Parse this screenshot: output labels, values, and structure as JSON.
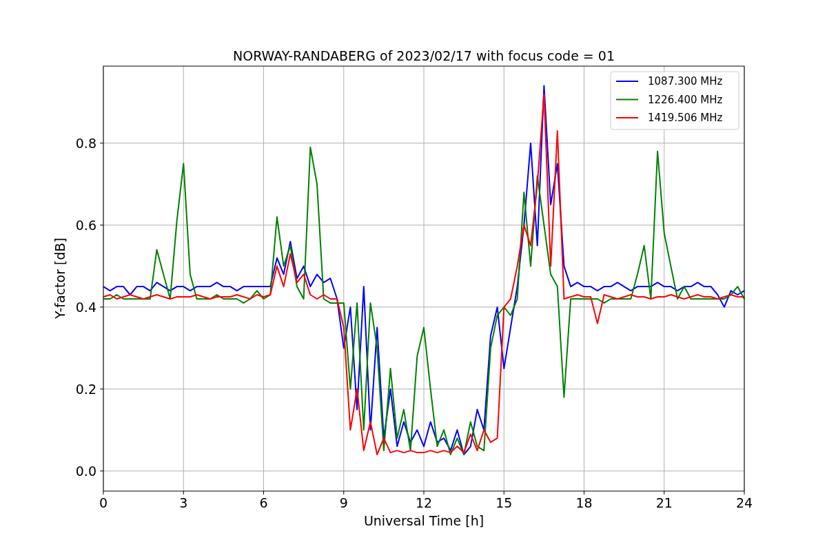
{
  "chart_data": {
    "type": "line",
    "grid": true,
    "legend": true,
    "title": "NORWAY-RANDABERG of 2023/02/17 with focus code = 01",
    "xlabel": "Universal Time [h]",
    "ylabel": "Y-factor [dB]",
    "xlim": [
      0,
      24
    ],
    "ylim": [
      -0.049,
      0.988
    ],
    "xticks": [
      0,
      3,
      6,
      9,
      12,
      15,
      18,
      21,
      24
    ],
    "yticks": [
      {
        "value": 0,
        "label": "0.0"
      },
      {
        "value": 0.2,
        "label": "0.2"
      },
      {
        "value": 0.4,
        "label": "0.4"
      },
      {
        "value": 0.6,
        "label": "0.6"
      },
      {
        "value": 0.8,
        "label": "0.8"
      }
    ],
    "x": [
      0,
      0.25,
      0.5,
      0.75,
      1,
      1.25,
      1.5,
      1.75,
      2,
      2.25,
      2.5,
      2.75,
      3,
      3.25,
      3.5,
      3.75,
      4,
      4.25,
      4.5,
      4.75,
      5,
      5.25,
      5.5,
      5.75,
      6,
      6.25,
      6.5,
      6.75,
      7,
      7.25,
      7.5,
      7.75,
      8,
      8.25,
      8.5,
      8.75,
      9,
      9.25,
      9.5,
      9.75,
      10,
      10.25,
      10.5,
      10.75,
      11,
      11.25,
      11.5,
      11.75,
      12,
      12.25,
      12.5,
      12.75,
      13,
      13.25,
      13.5,
      13.75,
      14,
      14.25,
      14.5,
      14.75,
      15,
      15.25,
      15.5,
      15.75,
      16,
      16.25,
      16.5,
      16.75,
      17,
      17.25,
      17.5,
      17.75,
      18,
      18.25,
      18.5,
      18.75,
      19,
      19.25,
      19.5,
      19.75,
      20,
      20.25,
      20.5,
      20.75,
      21,
      21.25,
      21.5,
      21.75,
      22,
      22.25,
      22.5,
      22.75,
      23,
      23.25,
      23.5,
      23.75,
      24
    ],
    "series": [
      {
        "name": "1087.300 MHz",
        "color": "#0000ff",
        "values": [
          0.45,
          0.44,
          0.45,
          0.45,
          0.43,
          0.45,
          0.45,
          0.44,
          0.46,
          0.45,
          0.44,
          0.45,
          0.45,
          0.44,
          0.45,
          0.45,
          0.45,
          0.46,
          0.45,
          0.45,
          0.44,
          0.45,
          0.45,
          0.45,
          0.45,
          0.45,
          0.52,
          0.48,
          0.56,
          0.47,
          0.5,
          0.45,
          0.48,
          0.46,
          0.47,
          0.42,
          0.3,
          0.4,
          0.15,
          0.45,
          0.1,
          0.35,
          0.08,
          0.2,
          0.06,
          0.12,
          0.07,
          0.1,
          0.06,
          0.12,
          0.07,
          0.08,
          0.05,
          0.1,
          0.04,
          0.06,
          0.15,
          0.1,
          0.33,
          0.4,
          0.25,
          0.35,
          0.45,
          0.6,
          0.8,
          0.55,
          0.94,
          0.65,
          0.75,
          0.5,
          0.45,
          0.46,
          0.45,
          0.45,
          0.44,
          0.45,
          0.45,
          0.46,
          0.45,
          0.44,
          0.45,
          0.45,
          0.45,
          0.46,
          0.45,
          0.45,
          0.44,
          0.45,
          0.45,
          0.46,
          0.45,
          0.45,
          0.43,
          0.4,
          0.44,
          0.43,
          0.44
        ]
      },
      {
        "name": "1226.400 MHz",
        "color": "#008000",
        "values": [
          0.42,
          0.42,
          0.43,
          0.42,
          0.42,
          0.42,
          0.42,
          0.42,
          0.54,
          0.48,
          0.42,
          0.61,
          0.75,
          0.48,
          0.42,
          0.42,
          0.42,
          0.43,
          0.42,
          0.42,
          0.42,
          0.41,
          0.42,
          0.44,
          0.42,
          0.43,
          0.62,
          0.5,
          0.55,
          0.45,
          0.42,
          0.79,
          0.7,
          0.42,
          0.41,
          0.41,
          0.41,
          0.2,
          0.41,
          0.1,
          0.41,
          0.3,
          0.05,
          0.25,
          0.08,
          0.15,
          0.05,
          0.28,
          0.35,
          0.2,
          0.06,
          0.1,
          0.04,
          0.08,
          0.04,
          0.12,
          0.06,
          0.05,
          0.3,
          0.38,
          0.4,
          0.38,
          0.42,
          0.68,
          0.5,
          0.72,
          0.6,
          0.48,
          0.45,
          0.18,
          0.42,
          0.42,
          0.42,
          0.42,
          0.42,
          0.41,
          0.42,
          0.42,
          0.42,
          0.42,
          0.48,
          0.55,
          0.42,
          0.78,
          0.58,
          0.5,
          0.42,
          0.45,
          0.42,
          0.42,
          0.42,
          0.42,
          0.42,
          0.42,
          0.43,
          0.45,
          0.42
        ]
      },
      {
        "name": "1419.506 MHz",
        "color": "#ff0000",
        "values": [
          0.425,
          0.43,
          0.42,
          0.425,
          0.43,
          0.425,
          0.42,
          0.425,
          0.43,
          0.425,
          0.42,
          0.425,
          0.425,
          0.425,
          0.43,
          0.425,
          0.42,
          0.425,
          0.425,
          0.425,
          0.43,
          0.425,
          0.42,
          0.43,
          0.425,
          0.43,
          0.5,
          0.45,
          0.53,
          0.46,
          0.48,
          0.43,
          0.42,
          0.43,
          0.42,
          0.42,
          0.35,
          0.1,
          0.2,
          0.05,
          0.12,
          0.04,
          0.08,
          0.045,
          0.05,
          0.045,
          0.05,
          0.045,
          0.045,
          0.05,
          0.045,
          0.05,
          0.045,
          0.06,
          0.045,
          0.09,
          0.05,
          0.1,
          0.07,
          0.08,
          0.4,
          0.42,
          0.5,
          0.6,
          0.55,
          0.7,
          0.92,
          0.5,
          0.83,
          0.42,
          0.425,
          0.43,
          0.425,
          0.425,
          0.36,
          0.43,
          0.425,
          0.42,
          0.425,
          0.43,
          0.425,
          0.425,
          0.42,
          0.425,
          0.425,
          0.43,
          0.425,
          0.42,
          0.425,
          0.43,
          0.425,
          0.425,
          0.42,
          0.425,
          0.43,
          0.425,
          0.425
        ]
      }
    ]
  }
}
